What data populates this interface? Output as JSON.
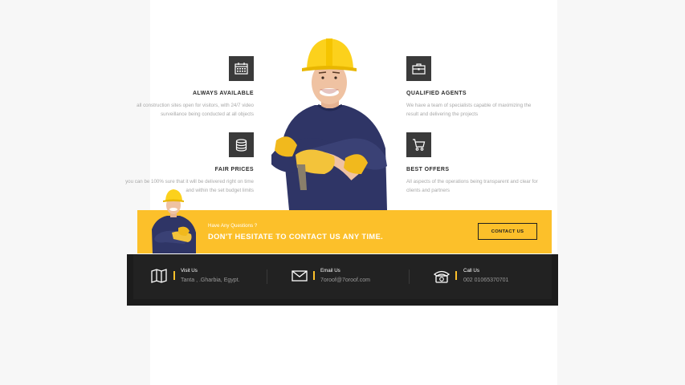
{
  "features": [
    {
      "title": "ALWAYS AVAILABLE",
      "icon": "calendar-icon",
      "description": "all construction sites open for visitors, with 24/7 video surveillance being conducted at all objects"
    },
    {
      "title": "QUALIFIED AGENTS",
      "icon": "briefcase-icon",
      "description": "We have a team of specialists capable of maximizing the result and delivering the projects"
    },
    {
      "title": "FAIR PRICES",
      "icon": "coins-icon",
      "description": "you can be 100% sure that it will be delivered right on time and within the set budget limits"
    },
    {
      "title": "BEST OFFERS",
      "icon": "cart-icon",
      "description": "All aspects of the operations being transparent and clear for clients and partners"
    }
  ],
  "cta": {
    "small_text": "Have Any Questions ?",
    "headline": "DON'T HESITATE TO CONTACT US ANY TIME.",
    "button_label": "CONTACT US"
  },
  "contact": [
    {
      "label": "Visit Us",
      "value": "Tanta , .Gharbia, Egypt.",
      "icon": "map-icon"
    },
    {
      "label": "Email Us",
      "value": "7oroof@7oroof.com",
      "icon": "envelope-icon"
    },
    {
      "label": "Call Us",
      "value": "002 01065370701",
      "icon": "phone-icon"
    }
  ],
  "colors": {
    "accent": "#fcc02a",
    "dark": "#1c1c1c",
    "icon_box": "#3a3a3a"
  }
}
